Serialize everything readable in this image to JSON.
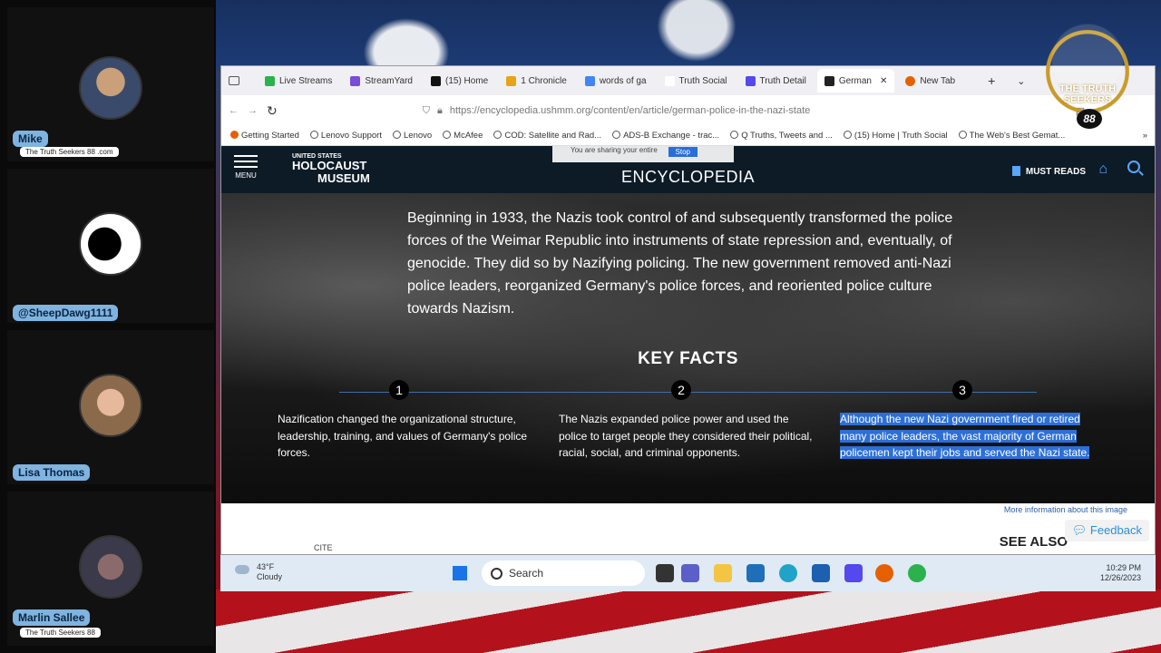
{
  "participants": [
    {
      "name": "Mike",
      "sub": "The Truth Seekers 88 .com"
    },
    {
      "name": "@SheepDawg1111",
      "sub": ""
    },
    {
      "name": "Lisa Thomas",
      "sub": ""
    },
    {
      "name": "Marlin Sallee",
      "sub": "The Truth Seekers 88"
    }
  ],
  "tabs": [
    {
      "label": "Live Streams",
      "color": "#2bb24c"
    },
    {
      "label": "StreamYard",
      "color": "#7a4ad8"
    },
    {
      "label": "(15) Home",
      "color": "#111111"
    },
    {
      "label": "1 Chronicle",
      "color": "#e8a317"
    },
    {
      "label": "words of ga",
      "color": "#4285f4"
    },
    {
      "label": "Truth Social",
      "color": "#ffffff"
    },
    {
      "label": "Truth Detail",
      "color": "#5448ee"
    },
    {
      "label": "German",
      "color": "#222222"
    },
    {
      "label": "New Tab",
      "color": "#e66000"
    }
  ],
  "url": "https://encyclopedia.ushmm.org/content/en/article/german-police-in-the-nazi-state",
  "bookmarks": [
    "Getting Started",
    "Lenovo Support",
    "Lenovo",
    "McAfee",
    "COD: Satellite and Rad...",
    "ADS-B Exchange - trac...",
    "Q Truths, Tweets and ...",
    "(15) Home | Truth Social",
    "The Web's Best Gemat..."
  ],
  "site": {
    "menu": "MENU",
    "logo_l1": "UNITED STATES",
    "logo_l2": "HOLOCAUST",
    "logo_l3": "MUSEUM",
    "title": "ENCYCLOPEDIA",
    "share_text": "You are sharing your entire",
    "stop": "Stop",
    "must_reads": "MUST READS"
  },
  "intro": "Beginning in 1933, the Nazis took control of and subsequently transformed the police forces of the Weimar Republic into instruments of state repression and, eventually, of genocide. They did so by Nazifying policing. The new government removed anti-Nazi police leaders, reorganized Germany's police forces, and reoriented police culture towards Nazism.",
  "key_facts_title": "KEY FACTS",
  "facts": [
    {
      "num": "1",
      "text": "Nazification changed the organizational structure, leadership, training, and values of Germany's police forces."
    },
    {
      "num": "2",
      "text": "The Nazis expanded police power and used the police to target people they considered their political, racial, social, and criminal opponents."
    },
    {
      "num": "3",
      "text": "Although the new Nazi government fired or retired many police leaders, the vast majority of German policemen kept their jobs and served the Nazi state."
    }
  ],
  "cite": "CITE",
  "more_info": "More information about this image",
  "see_also": "SEE ALSO",
  "feedback": "Feedback",
  "taskbar": {
    "temp": "43°F",
    "weather": "Cloudy",
    "search": "Search",
    "time": "10:29 PM",
    "date": "12/26/2023"
  },
  "overlay_logo": {
    "text": "THE TRUTH SEEKERS",
    "badge": "88"
  }
}
